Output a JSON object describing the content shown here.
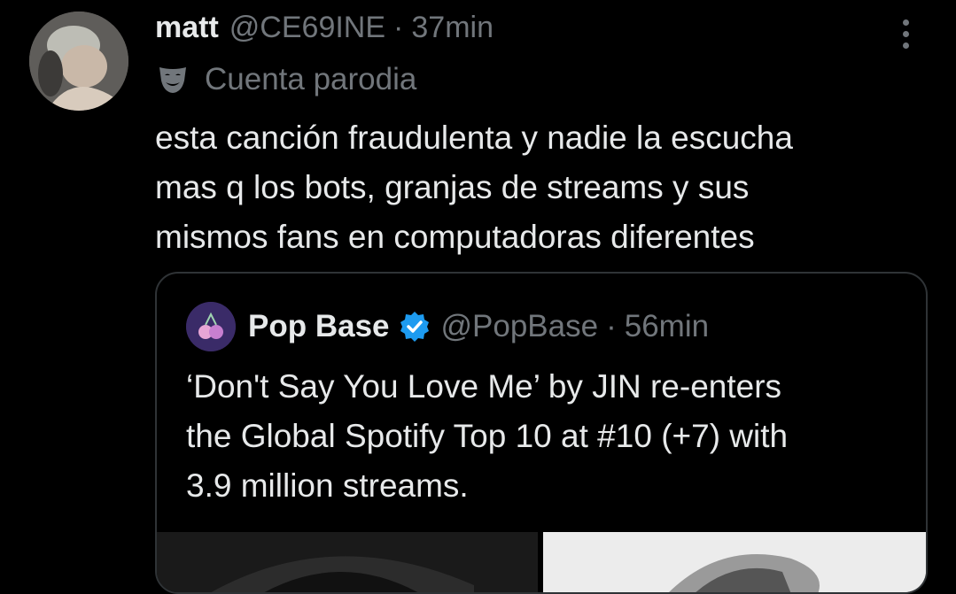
{
  "tweet": {
    "author_name": "matt",
    "author_handle": "@CE69INE",
    "separator": "·",
    "time": "37min",
    "parody_label": "Cuenta parodia",
    "text": "esta canción fraudulenta y nadie la escucha\nmas q los bots, granjas de streams y sus\nmismos fans en computadoras diferentes"
  },
  "quoted": {
    "author_name": "Pop Base",
    "author_handle": "@PopBase",
    "separator": "·",
    "time": "56min",
    "text": "‘Don't Say You Love Me’ by JIN re-enters\nthe Global Spotify Top 10 at #10 (+7) with\n3.9 million streams."
  },
  "icons": {
    "more": "more-vertical-icon",
    "parody": "theater-mask-icon",
    "verified": "verified-badge-icon"
  },
  "colors": {
    "background": "#000000",
    "text_primary": "#e7e9ea",
    "text_secondary": "#71767b",
    "border": "#2f3336",
    "verified_blue": "#1d9bf0"
  }
}
